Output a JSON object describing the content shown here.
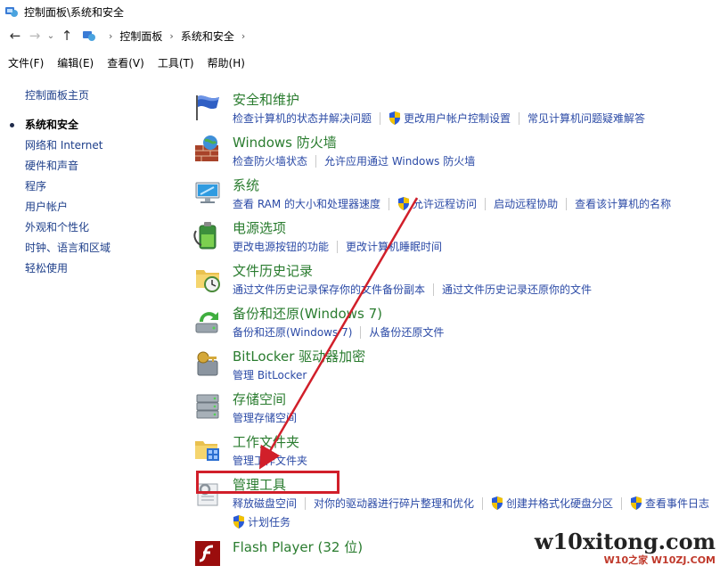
{
  "window": {
    "title": "控制面板\\系统和安全"
  },
  "address": {
    "crumbs": [
      "控制面板",
      "系统和安全"
    ]
  },
  "menu": [
    "文件(F)",
    "编辑(E)",
    "查看(V)",
    "工具(T)",
    "帮助(H)"
  ],
  "sidebar": {
    "home": "控制面板主页",
    "items": [
      "系统和安全",
      "网络和 Internet",
      "硬件和声音",
      "程序",
      "用户帐户",
      "外观和个性化",
      "时钟、语言和区域",
      "轻松使用"
    ]
  },
  "categories": [
    {
      "title": "安全和维护",
      "icon": "flag-icon",
      "links": [
        {
          "text": "检查计算机的状态并解决问题",
          "shield": false
        },
        {
          "text": "更改用户帐户控制设置",
          "shield": true
        },
        {
          "text": "常见计算机问题疑难解答",
          "shield": false
        }
      ]
    },
    {
      "title": "Windows 防火墙",
      "icon": "firewall-icon",
      "links": [
        {
          "text": "检查防火墙状态",
          "shield": false
        },
        {
          "text": "允许应用通过 Windows 防火墙",
          "shield": false
        }
      ]
    },
    {
      "title": "系统",
      "icon": "computer-icon",
      "links": [
        {
          "text": "查看 RAM 的大小和处理器速度",
          "shield": false
        },
        {
          "text": "允许远程访问",
          "shield": true
        },
        {
          "text": "启动远程协助",
          "shield": false
        },
        {
          "text": "查看该计算机的名称",
          "shield": false
        }
      ]
    },
    {
      "title": "电源选项",
      "icon": "battery-icon",
      "links": [
        {
          "text": "更改电源按钮的功能",
          "shield": false
        },
        {
          "text": "更改计算机睡眠时间",
          "shield": false
        }
      ]
    },
    {
      "title": "文件历史记录",
      "icon": "file-history-icon",
      "links": [
        {
          "text": "通过文件历史记录保存你的文件备份副本",
          "shield": false
        },
        {
          "text": "通过文件历史记录还原你的文件",
          "shield": false
        }
      ]
    },
    {
      "title": "备份和还原(Windows 7)",
      "icon": "backup-icon",
      "links": [
        {
          "text": "备份和还原(Windows 7)",
          "shield": false
        },
        {
          "text": "从备份还原文件",
          "shield": false
        }
      ]
    },
    {
      "title": "BitLocker 驱动器加密",
      "icon": "bitlocker-icon",
      "links": [
        {
          "text": "管理 BitLocker",
          "shield": false
        }
      ]
    },
    {
      "title": "存储空间",
      "icon": "storage-icon",
      "links": [
        {
          "text": "管理存储空间",
          "shield": false
        }
      ]
    },
    {
      "title": "工作文件夹",
      "icon": "work-folder-icon",
      "links": [
        {
          "text": "管理工作文件夹",
          "shield": false
        }
      ]
    },
    {
      "title": "管理工具",
      "icon": "admin-tools-icon",
      "links": [
        {
          "text": "释放磁盘空间",
          "shield": false
        },
        {
          "text": "对你的驱动器进行碎片整理和优化",
          "shield": false
        },
        {
          "text": "创建并格式化硬盘分区",
          "shield": true
        },
        {
          "text": "查看事件日志",
          "shield": true
        },
        {
          "text": "计划任务",
          "shield": true
        }
      ]
    },
    {
      "title": "Flash Player (32 位)",
      "icon": "flash-icon",
      "links": []
    }
  ],
  "watermark": {
    "main": "w10xitong.com",
    "sub": "W10之家 W10ZJ.COM"
  },
  "colors": {
    "category_title": "#2a7c2f",
    "link": "#2b4aa6",
    "annotation": "#d11f2a"
  }
}
